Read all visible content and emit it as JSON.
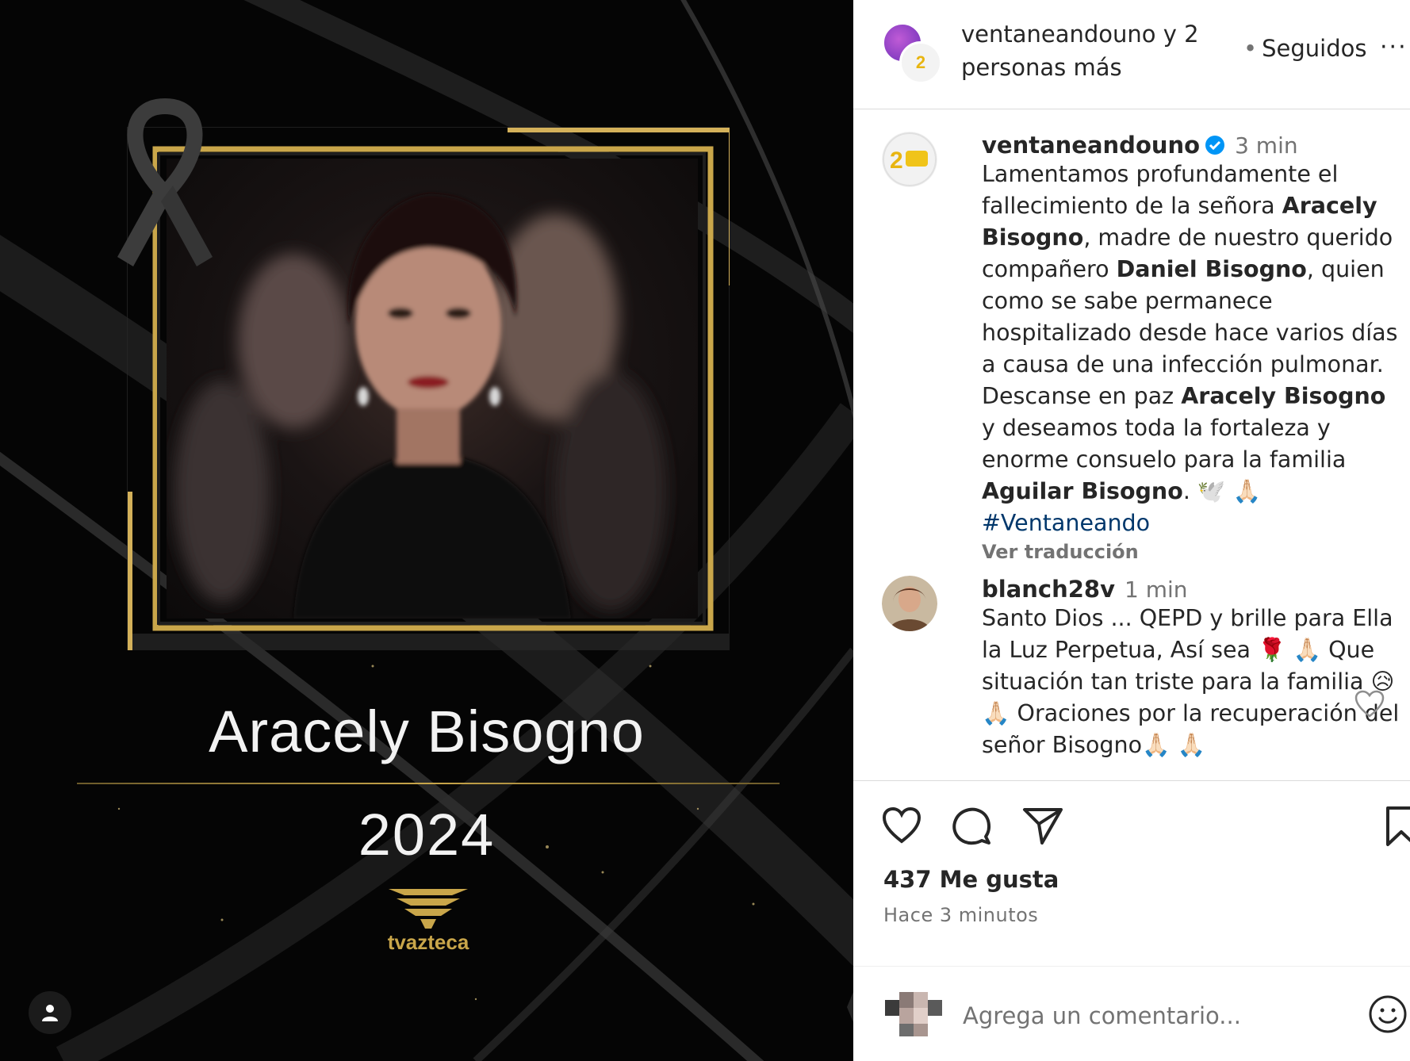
{
  "post_image": {
    "name": "Aracely Bisogno",
    "year": "2024",
    "brand": "tvazteca",
    "accent_color": "#c9a64a"
  },
  "header": {
    "owners": "ventaneandouno y 2 personas más",
    "follow_state": "Seguidos",
    "more": "···"
  },
  "caption": {
    "user": "ventaneandouno",
    "time": "3 min",
    "parts": {
      "p1": "Lamentamos profundamente el fallecimiento de la señora ",
      "b1": "Aracely Bisogno",
      "p2": ", madre de nuestro querido compañero ",
      "b2": "Daniel Bisogno",
      "p3": ", quien como se sabe permanece hospitalizado desde hace varios días a causa de una infección pulmonar. Descanse en paz ",
      "b3": "Aracely Bisogno",
      "p4": " y deseamos toda la fortaleza y enorme consuelo para la familia ",
      "b4": "Aguilar Bisogno",
      "p5": ". 🕊️ 🙏🏻 ",
      "hashtag": "#Ventaneando"
    },
    "translate": "Ver traducción"
  },
  "comment": {
    "user": "blanch28v",
    "time": "1 min",
    "text": "Santo Dios ... QEPD y brille para Ella la Luz Perpetua, Así sea 🌹 🙏🏻 Que situación tan triste para la familia 😥 🙏🏻 Oraciones por la recuperación del señor Bisogno🙏🏻 🙏🏻"
  },
  "actions": {
    "likes": "437 Me gusta",
    "posted": "Hace 3 minutos"
  },
  "add_comment": {
    "placeholder": "Agrega un comentario..."
  },
  "icons": [
    "tag-user-icon",
    "like-icon",
    "comment-icon",
    "share-icon",
    "save-icon",
    "emoji-icon",
    "verified-badge-icon",
    "mourning-ribbon-icon",
    "tvazteca-logo-icon"
  ]
}
